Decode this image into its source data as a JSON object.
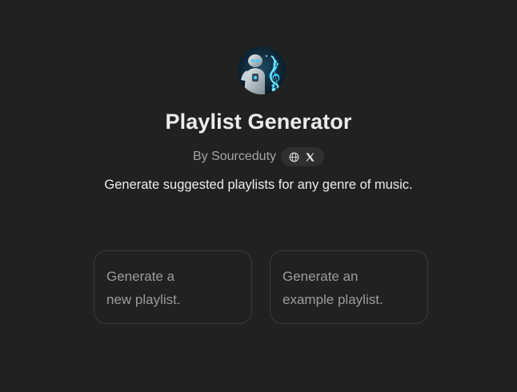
{
  "gpt": {
    "avatar_icon": "robot-treble-clef-avatar",
    "title": "Playlist Generator",
    "byline": "By Sourceduty",
    "social_icons": [
      "globe-icon",
      "x-logo-icon"
    ],
    "description": "Generate suggested playlists for any genre of music."
  },
  "conversation_starters": [
    {
      "label": "Generate a\nnew playlist."
    },
    {
      "label": "Generate an\nexample playlist."
    }
  ],
  "colors": {
    "background": "#212121",
    "title_text": "#ececec",
    "muted_text": "#a3a3a3",
    "starter_border": "#3a3a3a",
    "pill_background": "#2f2f2f",
    "avatar_accent": "#3fd0ff"
  }
}
